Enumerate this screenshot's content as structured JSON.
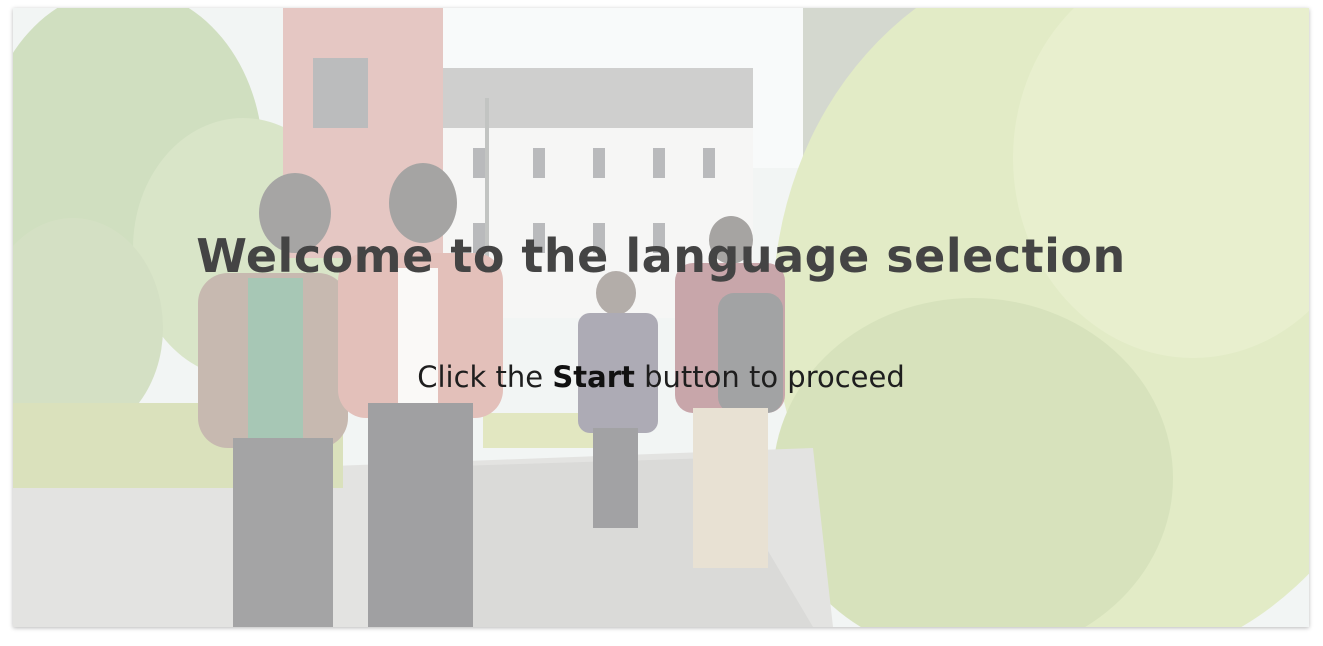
{
  "welcome": {
    "title": "Welcome to the language selection",
    "instruction_before": "Click the",
    "instruction_bold": "Start",
    "instruction_after": "button to proceed"
  },
  "background": {
    "description_icon": "campus-photo",
    "overlay_color": "#ffffff"
  }
}
